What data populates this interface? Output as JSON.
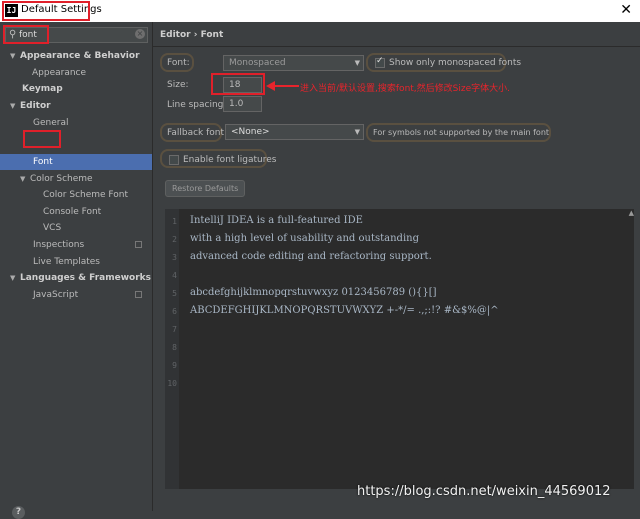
{
  "window": {
    "title": "Default Settings",
    "app_icon": "IJ"
  },
  "search": {
    "value": "font",
    "clear_glyph": "×"
  },
  "tree": {
    "appearance_behavior": "Appearance & Behavior",
    "appearance": "Appearance",
    "keymap": "Keymap",
    "editor": "Editor",
    "general": "General",
    "font": "Font",
    "color_scheme": "Color Scheme",
    "color_scheme_font": "Color Scheme Font",
    "console_font": "Console Font",
    "vcs": "VCS",
    "inspections": "Inspections",
    "live_templates": "Live Templates",
    "languages_frameworks": "Languages & Frameworks",
    "javascript": "JavaScript"
  },
  "help_glyph": "?",
  "breadcrumb": "Editor › Font",
  "font_panel": {
    "font_label": "Font:",
    "font_value": "Monospaced",
    "show_mono_label": "Show only monospaced fonts",
    "size_label": "Size:",
    "size_value": "18",
    "line_spacing_label": "Line spacing:",
    "line_spacing_value": "1.0",
    "fallback_label": "Fallback font:",
    "fallback_value": "<None>",
    "fallback_hint": "For symbols not supported by the main font",
    "ligatures_label": "Enable font ligatures",
    "restore_defaults": "Restore Defaults"
  },
  "annotation": "进入当前/默认设置,搜索font,然后修改Size字体大小.",
  "preview": {
    "lines": [
      "IntelliJ IDEA is a full-featured IDE",
      "with a high level of usability and outstanding",
      "advanced code editing and refactoring support.",
      "",
      "abcdefghijklmnopqrstuvwxyz 0123456789 (){}[]",
      "ABCDEFGHIJKLMNOPQRSTUVWXYZ +-*/= .,;:!? #&$%@|^"
    ],
    "line_numbers": [
      "1",
      "2",
      "3",
      "4",
      "5",
      "6",
      "7",
      "8",
      "9",
      "10"
    ]
  },
  "watermark": "https://blog.csdn.net/weixin_44569012",
  "colors": {
    "selection": "#4b6eaf",
    "highlight": "#e0202a",
    "editor_bg": "#2b2b2b",
    "panel_bg": "#3c3f41"
  }
}
